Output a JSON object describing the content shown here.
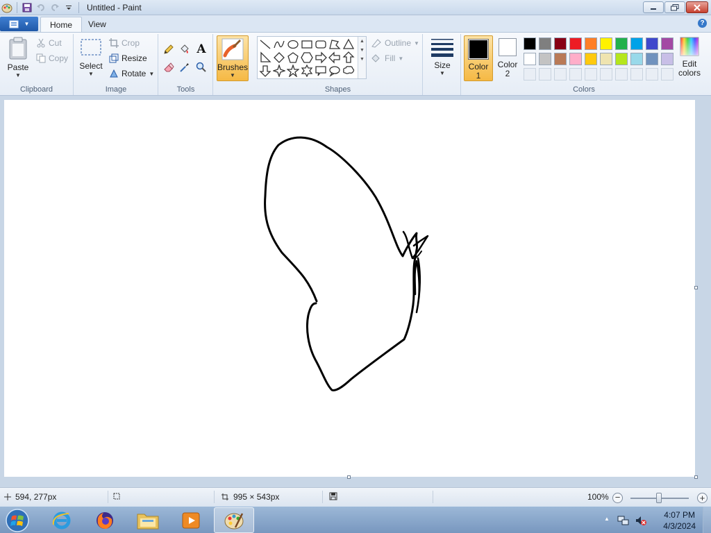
{
  "window": {
    "title": "Untitled - Paint"
  },
  "tabs": [
    {
      "label": "Home"
    },
    {
      "label": "View"
    }
  ],
  "clipboard": {
    "paste": "Paste",
    "cut": "Cut",
    "copy": "Copy",
    "group": "Clipboard"
  },
  "image": {
    "select": "Select",
    "crop": "Crop",
    "resize": "Resize",
    "rotate": "Rotate",
    "group": "Image"
  },
  "tools": {
    "group": "Tools"
  },
  "brushes": {
    "label": "Brushes"
  },
  "shapes": {
    "outline": "Outline",
    "fill": "Fill",
    "group": "Shapes"
  },
  "size": {
    "label": "Size"
  },
  "colors": {
    "color1_label": "Color",
    "color1_num": "1",
    "color2_label": "Color",
    "color2_num": "2",
    "edit_label": "Edit",
    "edit_label2": "colors",
    "group": "Colors",
    "color1_value": "#000000",
    "color2_value": "#ffffff",
    "palette_row1": [
      "#000000",
      "#7f7f7f",
      "#880015",
      "#ed1c24",
      "#ff7f27",
      "#fff200",
      "#22b14c",
      "#00a2e8",
      "#3f48cc",
      "#a349a4"
    ],
    "palette_row2": [
      "#ffffff",
      "#c3c3c3",
      "#b97a57",
      "#ffaec9",
      "#ffc90e",
      "#efe4b0",
      "#b5e61d",
      "#99d9ea",
      "#7092be",
      "#c8bfe7"
    ]
  },
  "status": {
    "cursor_pos": "594, 277px",
    "canvas_size": "995 × 543px",
    "zoom": "100%"
  },
  "taskbar": {
    "time": "4:07 PM",
    "date": "4/3/2024"
  }
}
